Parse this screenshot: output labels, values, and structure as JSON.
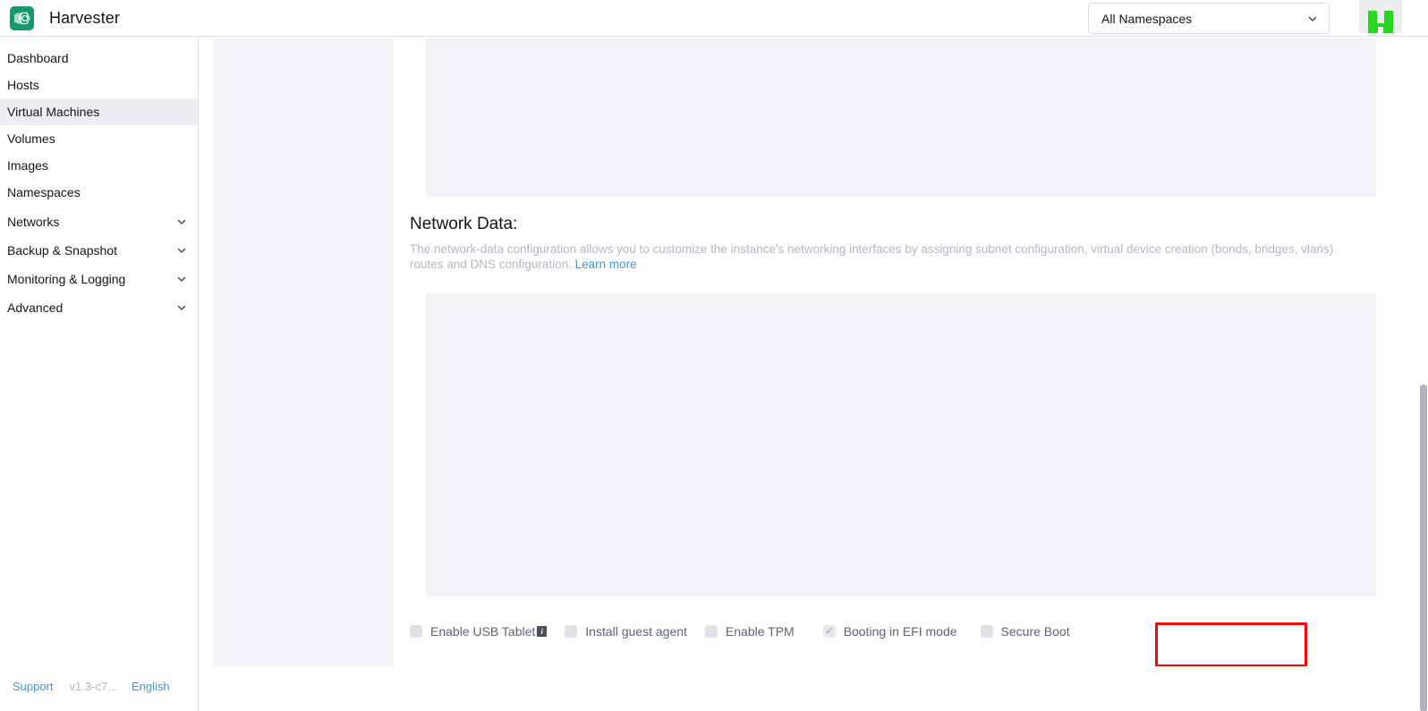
{
  "header": {
    "product_name": "Harvester",
    "logo_icon": "harvester-logo-icon",
    "namespace_selector": {
      "value": "All Namespaces",
      "chevron_icon": "chevron-down-icon"
    },
    "corner_logo_icon": "rancher-logo-icon"
  },
  "sidebar": {
    "items": [
      {
        "label": "Dashboard",
        "expandable": false,
        "active": false
      },
      {
        "label": "Hosts",
        "expandable": false,
        "active": false
      },
      {
        "label": "Virtual Machines",
        "expandable": false,
        "active": true
      },
      {
        "label": "Volumes",
        "expandable": false,
        "active": false
      },
      {
        "label": "Images",
        "expandable": false,
        "active": false
      },
      {
        "label": "Namespaces",
        "expandable": false,
        "active": false
      },
      {
        "label": "Networks",
        "expandable": true,
        "active": false
      },
      {
        "label": "Backup & Snapshot",
        "expandable": true,
        "active": false
      },
      {
        "label": "Monitoring & Logging",
        "expandable": true,
        "active": false
      },
      {
        "label": "Advanced",
        "expandable": true,
        "active": false
      }
    ],
    "chevron_icon": "chevron-down-icon"
  },
  "footer": {
    "support_label": "Support",
    "version": "v1.3-c7...",
    "language": "English"
  },
  "main": {
    "cloud_config_editor": {
      "content": ""
    },
    "network_data": {
      "title": "Network Data:",
      "description_before": "The network-data configuration allows you to customize the instance's networking interfaces by assigning subnet configuration, virtual device creation (bonds, bridges, vlans) routes and DNS configuration.",
      "learn_more_label": "Learn more",
      "editor_content": ""
    },
    "options": [
      {
        "label": "Enable USB Tablet",
        "checked": false,
        "has_info_icon": true,
        "highlighted": false
      },
      {
        "label": "Install guest agent",
        "checked": false,
        "has_info_icon": false,
        "highlighted": false
      },
      {
        "label": "Enable TPM",
        "checked": false,
        "has_info_icon": false,
        "highlighted": false
      },
      {
        "label": "Booting in EFI mode",
        "checked": true,
        "has_info_icon": false,
        "highlighted": true
      },
      {
        "label": "Secure Boot",
        "checked": false,
        "has_info_icon": false,
        "highlighted": false
      }
    ],
    "check_glyph": "✓",
    "info_glyph": "i",
    "highlight_color": "#f60606"
  }
}
